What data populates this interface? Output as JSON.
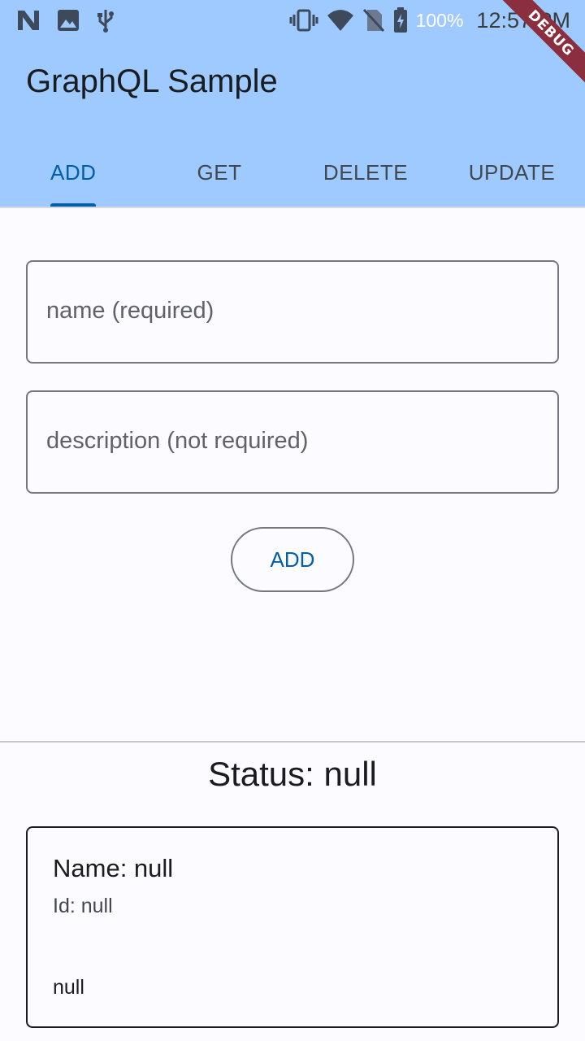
{
  "status_bar": {
    "icons_left": [
      "n-logo-icon",
      "image-icon",
      "usb-icon"
    ],
    "icons_right": [
      "vibrate-icon",
      "wifi-icon",
      "no-sim-icon",
      "battery-charging-icon"
    ],
    "battery": "100%",
    "time": "12:57 PM"
  },
  "debug_banner": "DEBUG",
  "app_bar": {
    "title": "GraphQL Sample",
    "background": "#9ecaff"
  },
  "tabs": [
    {
      "label": "ADD",
      "selected": true
    },
    {
      "label": "GET",
      "selected": false
    },
    {
      "label": "DELETE",
      "selected": false
    },
    {
      "label": "UPDATE",
      "selected": false
    }
  ],
  "form": {
    "name_placeholder": "name (required)",
    "description_placeholder": "description (not required)",
    "add_button": "ADD"
  },
  "result": {
    "status": "Status: null",
    "name": "Name: null",
    "id": "Id: null",
    "description": "null"
  },
  "colors": {
    "accent": "#005fab",
    "outline": "#74777f"
  }
}
